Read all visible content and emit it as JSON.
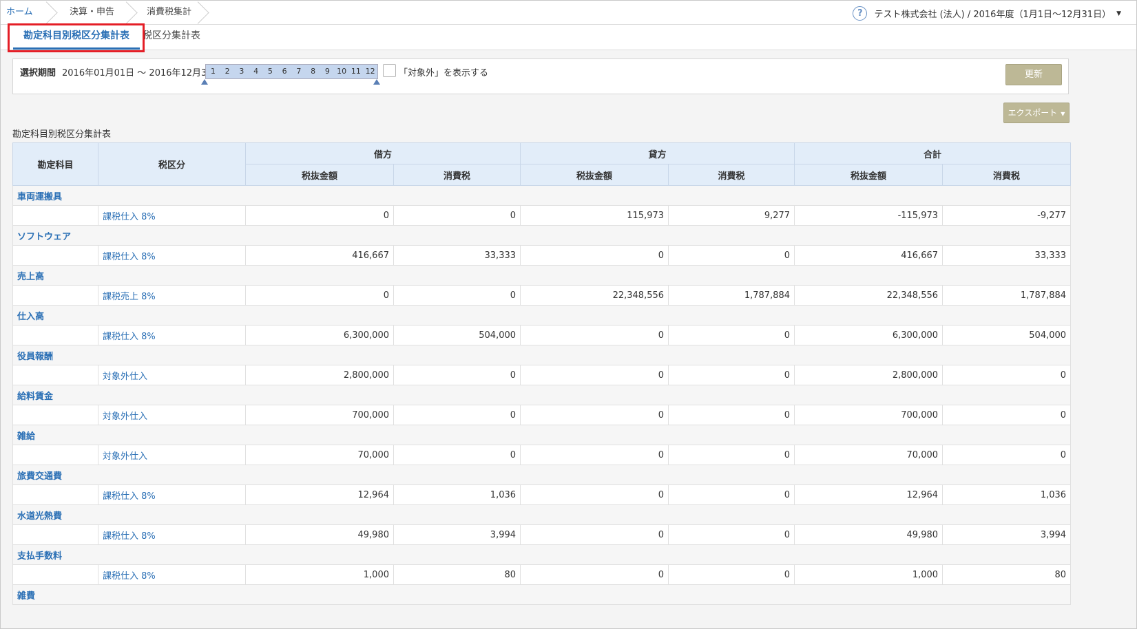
{
  "breadcrumb": [
    "ホーム",
    "決算・申告",
    "消費税集計"
  ],
  "company": {
    "text": "テスト株式会社 (法人) / 2016年度（1月1日〜12月31日）",
    "help": "?",
    "caret": "▼"
  },
  "tabs": [
    {
      "label": "勘定科目別税区分集計表",
      "active": true
    },
    {
      "label": "税区分集計表",
      "active": false
    }
  ],
  "filter": {
    "label": "選択期間",
    "range": "2016年01月01日 〜 2016年12月31日",
    "months": [
      "1",
      "2",
      "3",
      "4",
      "5",
      "6",
      "7",
      "8",
      "9",
      "10",
      "11",
      "12"
    ],
    "checkbox_label": "「対象外」を表示する",
    "checkbox_checked": false,
    "update_button": "更新"
  },
  "export_button": "エクスポート",
  "export_caret": "▼",
  "section_title": "勘定科目別税区分集計表",
  "table": {
    "headers": {
      "account": "勘定科目",
      "tax_class": "税区分",
      "debit": "借方",
      "credit": "貸方",
      "total": "合計",
      "excl": "税抜金額",
      "tax": "消費税"
    },
    "groups": [
      {
        "account": "車両運搬具",
        "rows": [
          {
            "tax_class": "課税仕入 8%",
            "values": [
              "0",
              "0",
              "115,973",
              "9,277",
              "-115,973",
              "-9,277"
            ]
          }
        ]
      },
      {
        "account": "ソフトウェア",
        "rows": [
          {
            "tax_class": "課税仕入 8%",
            "values": [
              "416,667",
              "33,333",
              "0",
              "0",
              "416,667",
              "33,333"
            ]
          }
        ]
      },
      {
        "account": "売上高",
        "rows": [
          {
            "tax_class": "課税売上 8%",
            "values": [
              "0",
              "0",
              "22,348,556",
              "1,787,884",
              "22,348,556",
              "1,787,884"
            ]
          }
        ]
      },
      {
        "account": "仕入高",
        "rows": [
          {
            "tax_class": "課税仕入 8%",
            "values": [
              "6,300,000",
              "504,000",
              "0",
              "0",
              "6,300,000",
              "504,000"
            ]
          }
        ]
      },
      {
        "account": "役員報酬",
        "rows": [
          {
            "tax_class": "対象外仕入",
            "values": [
              "2,800,000",
              "0",
              "0",
              "0",
              "2,800,000",
              "0"
            ]
          }
        ]
      },
      {
        "account": "給料賃金",
        "rows": [
          {
            "tax_class": "対象外仕入",
            "values": [
              "700,000",
              "0",
              "0",
              "0",
              "700,000",
              "0"
            ]
          }
        ]
      },
      {
        "account": "雑給",
        "rows": [
          {
            "tax_class": "対象外仕入",
            "values": [
              "70,000",
              "0",
              "0",
              "0",
              "70,000",
              "0"
            ]
          }
        ]
      },
      {
        "account": "旅費交通費",
        "rows": [
          {
            "tax_class": "課税仕入 8%",
            "values": [
              "12,964",
              "1,036",
              "0",
              "0",
              "12,964",
              "1,036"
            ]
          }
        ]
      },
      {
        "account": "水道光熱費",
        "rows": [
          {
            "tax_class": "課税仕入 8%",
            "values": [
              "49,980",
              "3,994",
              "0",
              "0",
              "49,980",
              "3,994"
            ]
          }
        ]
      },
      {
        "account": "支払手数料",
        "rows": [
          {
            "tax_class": "課税仕入 8%",
            "values": [
              "1,000",
              "80",
              "0",
              "0",
              "1,000",
              "80"
            ]
          }
        ]
      },
      {
        "account": "雑費",
        "rows": []
      }
    ]
  }
}
